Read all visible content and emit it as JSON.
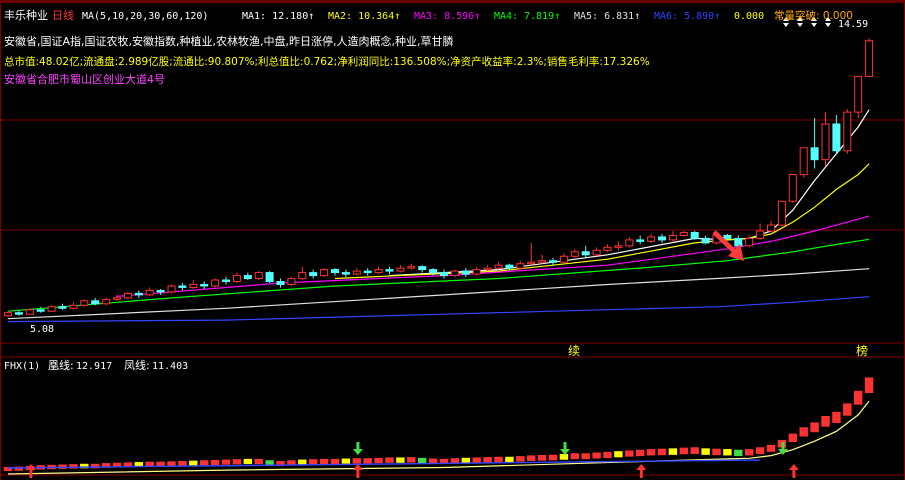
{
  "stock_name": "丰乐种业",
  "period_label": "日线",
  "ma_header": {
    "ma_params": "MA(5,10,20,30,60,120)",
    "items": [
      {
        "label": "MA1:",
        "value": "12.180",
        "color": "#ffffff"
      },
      {
        "label": "MA2:",
        "value": "10.364",
        "color": "#ffff00"
      },
      {
        "label": "MA3:",
        "value": "8.596",
        "color": "#ff00ff"
      },
      {
        "label": "MA4:",
        "value": "7.819",
        "color": "#00ff00"
      },
      {
        "label": "MA5:",
        "value": "6.831",
        "color": "#e0e0e0"
      },
      {
        "label": "MA6:",
        "value": "5.890",
        "color": "#3344ff"
      }
    ],
    "extra_value": "0.000",
    "breakout_label": "常量突破:",
    "breakout_value": "0.000"
  },
  "info_lines": {
    "concepts": "安徽省,国证A指,国证农牧,安徽指数,种植业,农林牧渔,中盘,昨日涨停,人造肉概念,种业,草甘膦",
    "fundamentals": "总市值:48.02亿;流通盘:2.989亿股;流通比:90.807%;利总值比:0.762;净利润同比:136.508%;净资产收益率:2.3%;销售毛利率:17.326%",
    "address": "安徽省合肥市蜀山区创业大道4号"
  },
  "price_labels": {
    "high": "14.59",
    "low": "5.08"
  },
  "date_markers": [
    "续",
    "榜"
  ],
  "indicator": {
    "name": "FHX(1)",
    "line1_label": "凰线:",
    "line1_value": "12.917",
    "line2_label": "凤线:",
    "line2_value": "11.403"
  },
  "colors": {
    "up": "#ff3232",
    "down": "#54ffff",
    "grid": "#800000",
    "ma1": "#ffffff",
    "ma2": "#ffff00",
    "ma3": "#ff00ff",
    "ma4": "#00ff00",
    "ma5": "#e0e0e0",
    "ma6": "#3344ff",
    "arrow_buy": "#ff3232",
    "arrow_sell": "#44dd44"
  },
  "chart_data": {
    "type": "candlestick",
    "title": "丰乐种业 日线",
    "ylim": [
      4.6,
      15.2
    ],
    "candles": [
      [
        5.25,
        5.35,
        5.2,
        5.4
      ],
      [
        5.35,
        5.3,
        5.25,
        5.42
      ],
      [
        5.3,
        5.45,
        5.28,
        5.5
      ],
      [
        5.45,
        5.4,
        5.35,
        5.55
      ],
      [
        5.4,
        5.55,
        5.38,
        5.6
      ],
      [
        5.55,
        5.5,
        5.45,
        5.65
      ],
      [
        5.5,
        5.6,
        5.45,
        5.7
      ],
      [
        5.6,
        5.75,
        5.55,
        5.8
      ],
      [
        5.75,
        5.65,
        5.6,
        5.85
      ],
      [
        5.65,
        5.8,
        5.6,
        5.85
      ],
      [
        5.8,
        5.85,
        5.75,
        5.95
      ],
      [
        5.85,
        6.0,
        5.8,
        6.05
      ],
      [
        6.0,
        5.95,
        5.85,
        6.1
      ],
      [
        5.95,
        6.1,
        5.9,
        6.2
      ],
      [
        6.1,
        6.05,
        5.95,
        6.15
      ],
      [
        6.05,
        6.25,
        6.0,
        6.3
      ],
      [
        6.25,
        6.2,
        6.1,
        6.35
      ],
      [
        6.2,
        6.3,
        6.15,
        6.45
      ],
      [
        6.3,
        6.25,
        6.15,
        6.4
      ],
      [
        6.25,
        6.45,
        6.2,
        6.5
      ],
      [
        6.45,
        6.4,
        6.3,
        6.55
      ],
      [
        6.4,
        6.6,
        6.35,
        6.7
      ],
      [
        6.6,
        6.5,
        6.45,
        6.7
      ],
      [
        6.5,
        6.7,
        6.45,
        6.75
      ],
      [
        6.7,
        6.4,
        6.35,
        6.75
      ],
      [
        6.4,
        6.3,
        6.2,
        6.5
      ],
      [
        6.3,
        6.5,
        6.25,
        6.55
      ],
      [
        6.5,
        6.7,
        6.45,
        6.9
      ],
      [
        6.7,
        6.6,
        6.5,
        6.8
      ],
      [
        6.6,
        6.8,
        6.55,
        6.85
      ],
      [
        6.8,
        6.7,
        6.6,
        6.85
      ],
      [
        6.7,
        6.65,
        6.55,
        6.8
      ],
      [
        6.65,
        6.75,
        6.6,
        6.85
      ],
      [
        6.75,
        6.7,
        6.6,
        6.85
      ],
      [
        6.7,
        6.8,
        6.65,
        6.9
      ],
      [
        6.8,
        6.75,
        6.65,
        6.9
      ],
      [
        6.75,
        6.85,
        6.7,
        6.95
      ],
      [
        6.85,
        6.9,
        6.8,
        7.0
      ],
      [
        6.9,
        6.8,
        6.7,
        6.95
      ],
      [
        6.8,
        6.7,
        6.6,
        6.85
      ],
      [
        6.7,
        6.6,
        6.5,
        6.8
      ],
      [
        6.6,
        6.75,
        6.55,
        6.8
      ],
      [
        6.75,
        6.65,
        6.55,
        6.85
      ],
      [
        6.65,
        6.8,
        6.6,
        6.9
      ],
      [
        6.8,
        6.85,
        6.75,
        6.95
      ],
      [
        6.85,
        6.95,
        6.8,
        7.05
      ],
      [
        6.95,
        6.85,
        6.8,
        7.0
      ],
      [
        6.85,
        7.0,
        6.8,
        7.1
      ],
      [
        7.0,
        7.05,
        6.95,
        7.7
      ],
      [
        7.05,
        7.1,
        7.0,
        7.3
      ],
      [
        7.1,
        7.05,
        6.95,
        7.2
      ],
      [
        7.05,
        7.25,
        7.0,
        7.35
      ],
      [
        7.25,
        7.4,
        7.2,
        7.5
      ],
      [
        7.4,
        7.3,
        7.2,
        7.6
      ],
      [
        7.3,
        7.45,
        7.25,
        7.55
      ],
      [
        7.45,
        7.55,
        7.4,
        7.65
      ],
      [
        7.55,
        7.6,
        7.45,
        7.75
      ],
      [
        7.6,
        7.8,
        7.55,
        7.9
      ],
      [
        7.8,
        7.75,
        7.65,
        7.95
      ],
      [
        7.75,
        7.9,
        7.7,
        8.0
      ],
      [
        7.9,
        7.8,
        7.7,
        8.0
      ],
      [
        7.8,
        7.95,
        7.75,
        8.1
      ],
      [
        7.95,
        8.05,
        7.9,
        8.1
      ],
      [
        8.05,
        7.85,
        7.8,
        8.1
      ],
      [
        7.85,
        7.7,
        7.65,
        7.95
      ],
      [
        7.7,
        7.95,
        7.65,
        8.0
      ],
      [
        7.95,
        7.85,
        7.8,
        8.0
      ],
      [
        7.85,
        7.6,
        7.55,
        7.95
      ],
      [
        7.6,
        7.85,
        7.55,
        7.95
      ],
      [
        7.85,
        8.1,
        7.8,
        8.35
      ],
      [
        8.1,
        8.3,
        8.05,
        8.45
      ],
      [
        8.3,
        9.1,
        8.25,
        9.1
      ],
      [
        9.1,
        10.0,
        9.05,
        10.0
      ],
      [
        10.0,
        10.9,
        9.9,
        10.9
      ],
      [
        10.9,
        10.5,
        10.2,
        11.9
      ],
      [
        10.5,
        11.7,
        10.3,
        12.1
      ],
      [
        11.7,
        10.8,
        10.7,
        12.0
      ],
      [
        10.8,
        12.1,
        10.7,
        12.2
      ],
      [
        12.1,
        13.3,
        11.9,
        13.3
      ],
      [
        13.3,
        14.5,
        14.0,
        14.59
      ]
    ],
    "ma_lines": {
      "MA1": [
        [
          35,
          6.6
        ],
        [
          45,
          6.8
        ],
        [
          55,
          7.3
        ],
        [
          63,
          7.85
        ],
        [
          66,
          7.8
        ],
        [
          68,
          7.85
        ],
        [
          70,
          8.1
        ],
        [
          72,
          8.8
        ],
        [
          74,
          9.8
        ],
        [
          76,
          10.7
        ],
        [
          78,
          11.6
        ],
        [
          79,
          12.18
        ]
      ],
      "MA2": [
        [
          30,
          6.5
        ],
        [
          45,
          6.75
        ],
        [
          55,
          7.15
        ],
        [
          63,
          7.7
        ],
        [
          66,
          7.8
        ],
        [
          68,
          7.85
        ],
        [
          70,
          8.0
        ],
        [
          72,
          8.4
        ],
        [
          74,
          8.9
        ],
        [
          76,
          9.5
        ],
        [
          78,
          10.0
        ],
        [
          79,
          10.36
        ]
      ],
      "MA3": [
        [
          10,
          5.9
        ],
        [
          25,
          6.35
        ],
        [
          40,
          6.6
        ],
        [
          55,
          6.95
        ],
        [
          62,
          7.3
        ],
        [
          66,
          7.5
        ],
        [
          70,
          7.75
        ],
        [
          74,
          8.1
        ],
        [
          77,
          8.4
        ],
        [
          79,
          8.6
        ]
      ],
      "MA4": [
        [
          0,
          5.4
        ],
        [
          15,
          5.85
        ],
        [
          30,
          6.25
        ],
        [
          45,
          6.5
        ],
        [
          58,
          6.85
        ],
        [
          66,
          7.1
        ],
        [
          72,
          7.4
        ],
        [
          76,
          7.65
        ],
        [
          79,
          7.82
        ]
      ],
      "MA5": [
        [
          0,
          5.15
        ],
        [
          20,
          5.5
        ],
        [
          40,
          5.95
        ],
        [
          55,
          6.3
        ],
        [
          65,
          6.5
        ],
        [
          72,
          6.65
        ],
        [
          79,
          6.83
        ]
      ],
      "MA6": [
        [
          0,
          5.05
        ],
        [
          20,
          5.1
        ],
        [
          40,
          5.3
        ],
        [
          55,
          5.45
        ],
        [
          65,
          5.55
        ],
        [
          72,
          5.7
        ],
        [
          79,
          5.89
        ]
      ]
    },
    "sub_indicator": {
      "name": "FHX(1)",
      "ylim": [
        0,
        14
      ],
      "bars": [
        [
          0,
          0.15,
          "up"
        ],
        [
          1,
          0.2,
          "up"
        ],
        [
          2,
          0.3,
          "up"
        ],
        [
          3,
          0.4,
          "up"
        ],
        [
          4,
          0.45,
          "up"
        ],
        [
          5,
          0.5,
          "up"
        ],
        [
          6,
          0.55,
          "up"
        ],
        [
          7,
          0.6,
          "yellow"
        ],
        [
          8,
          0.6,
          "up"
        ],
        [
          9,
          0.7,
          "up"
        ],
        [
          10,
          0.75,
          "up"
        ],
        [
          11,
          0.8,
          "up"
        ],
        [
          12,
          0.85,
          "yellow"
        ],
        [
          13,
          0.9,
          "up"
        ],
        [
          14,
          0.9,
          "up"
        ],
        [
          15,
          0.95,
          "up"
        ],
        [
          16,
          1.0,
          "up"
        ],
        [
          17,
          1.05,
          "yellow"
        ],
        [
          18,
          1.1,
          "up"
        ],
        [
          19,
          1.15,
          "up"
        ],
        [
          20,
          1.2,
          "up"
        ],
        [
          21,
          1.25,
          "up"
        ],
        [
          22,
          1.3,
          "yellow"
        ],
        [
          23,
          1.3,
          "up"
        ],
        [
          24,
          1.1,
          "green"
        ],
        [
          25,
          1.0,
          "up"
        ],
        [
          26,
          1.1,
          "up"
        ],
        [
          27,
          1.2,
          "yellow"
        ],
        [
          28,
          1.25,
          "up"
        ],
        [
          29,
          1.3,
          "up"
        ],
        [
          30,
          1.3,
          "up"
        ],
        [
          31,
          1.35,
          "yellow"
        ],
        [
          32,
          1.4,
          "up"
        ],
        [
          33,
          1.4,
          "up"
        ],
        [
          34,
          1.45,
          "up"
        ],
        [
          35,
          1.5,
          "up"
        ],
        [
          36,
          1.5,
          "yellow"
        ],
        [
          37,
          1.55,
          "up"
        ],
        [
          38,
          1.45,
          "green"
        ],
        [
          39,
          1.35,
          "up"
        ],
        [
          40,
          1.3,
          "up"
        ],
        [
          41,
          1.4,
          "up"
        ],
        [
          42,
          1.45,
          "yellow"
        ],
        [
          43,
          1.5,
          "up"
        ],
        [
          44,
          1.55,
          "up"
        ],
        [
          45,
          1.6,
          "up"
        ],
        [
          46,
          1.6,
          "yellow"
        ],
        [
          47,
          1.7,
          "up"
        ],
        [
          48,
          1.8,
          "up"
        ],
        [
          49,
          1.85,
          "up"
        ],
        [
          50,
          1.9,
          "up"
        ],
        [
          51,
          2.0,
          "yellow"
        ],
        [
          52,
          2.1,
          "up"
        ],
        [
          53,
          2.1,
          "up"
        ],
        [
          54,
          2.2,
          "up"
        ],
        [
          55,
          2.3,
          "up"
        ],
        [
          56,
          2.4,
          "yellow"
        ],
        [
          57,
          2.5,
          "up"
        ],
        [
          58,
          2.6,
          "up"
        ],
        [
          59,
          2.7,
          "up"
        ],
        [
          60,
          2.75,
          "up"
        ],
        [
          61,
          2.8,
          "yellow"
        ],
        [
          62,
          2.9,
          "up"
        ],
        [
          63,
          2.95,
          "up"
        ],
        [
          64,
          2.8,
          "yellow"
        ],
        [
          65,
          2.75,
          "up"
        ],
        [
          66,
          2.7,
          "yellow"
        ],
        [
          67,
          2.6,
          "green"
        ],
        [
          68,
          2.7,
          "up"
        ],
        [
          69,
          2.95,
          "up"
        ],
        [
          70,
          3.3,
          "up"
        ],
        [
          71,
          4.0,
          "up"
        ],
        [
          72,
          4.9,
          "up"
        ],
        [
          73,
          5.8,
          "up"
        ],
        [
          74,
          6.5,
          "up"
        ],
        [
          75,
          7.4,
          "up"
        ],
        [
          76,
          8.0,
          "up"
        ],
        [
          77,
          9.2,
          "up"
        ],
        [
          78,
          11.0,
          "up"
        ],
        [
          79,
          12.9,
          "up"
        ]
      ],
      "line": [
        [
          0,
          0.3
        ],
        [
          20,
          0.9
        ],
        [
          40,
          1.3
        ],
        [
          60,
          2.3
        ],
        [
          66,
          2.6
        ],
        [
          68,
          2.7
        ],
        [
          70,
          3.1
        ],
        [
          72,
          4.0
        ],
        [
          74,
          5.3
        ],
        [
          76,
          6.8
        ],
        [
          78,
          9.3
        ],
        [
          79,
          11.4
        ]
      ],
      "arrows": [
        [
          1,
          "buy"
        ],
        [
          31,
          "buy"
        ],
        [
          57,
          "buy"
        ],
        [
          71,
          "buy"
        ],
        [
          31,
          "sell"
        ],
        [
          50,
          "sell"
        ],
        [
          70,
          "sell"
        ]
      ]
    }
  }
}
